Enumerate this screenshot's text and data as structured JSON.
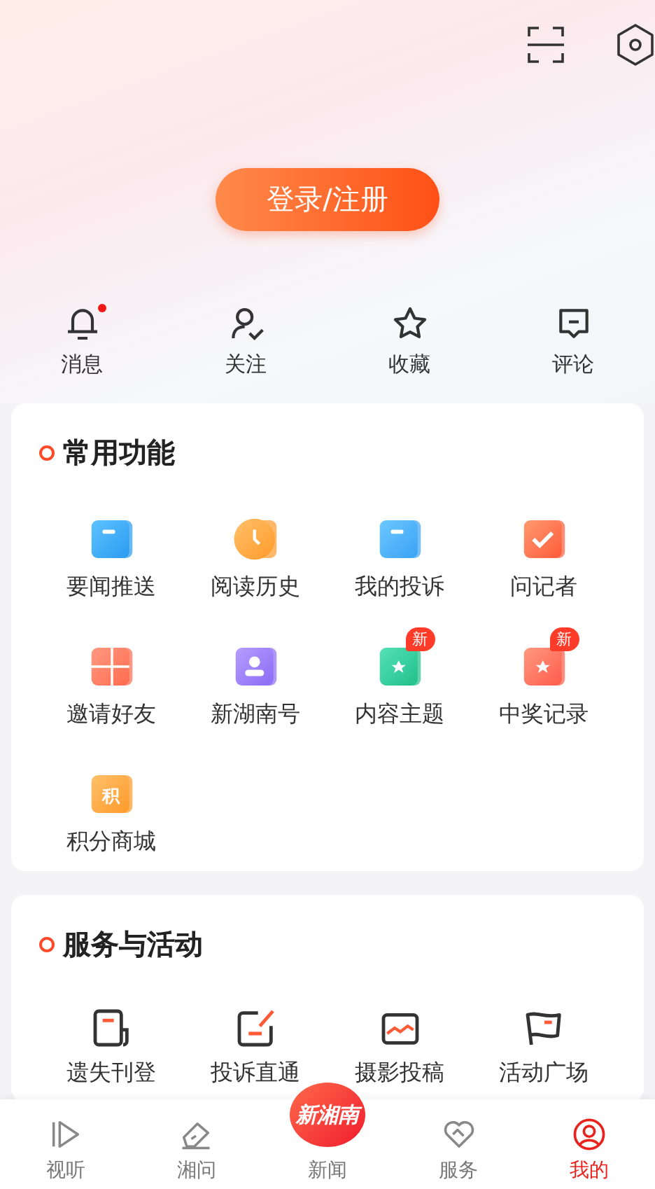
{
  "login_button": "登录/注册",
  "quick_actions": [
    {
      "label": "消息",
      "unread": true
    },
    {
      "label": "关注",
      "unread": false
    },
    {
      "label": "收藏",
      "unread": false
    },
    {
      "label": "评论",
      "unread": false
    }
  ],
  "sections": [
    {
      "title": "常用功能",
      "items": [
        {
          "label": "要闻推送"
        },
        {
          "label": "阅读历史"
        },
        {
          "label": "我的投诉"
        },
        {
          "label": "问记者"
        },
        {
          "label": "邀请好友"
        },
        {
          "label": "新湖南号"
        },
        {
          "label": "内容主题",
          "badge": "新"
        },
        {
          "label": "中奖记录",
          "badge": "新"
        },
        {
          "label": "积分商城",
          "icon_text": "积"
        }
      ]
    },
    {
      "title": "服务与活动",
      "items": [
        {
          "label": "遗失刊登"
        },
        {
          "label": "投诉直通"
        },
        {
          "label": "摄影投稿"
        },
        {
          "label": "活动广场"
        }
      ]
    }
  ],
  "tab_bar": {
    "logo_text": "新湘南",
    "items": [
      {
        "label": "视听",
        "selected": false
      },
      {
        "label": "湘问",
        "selected": false
      },
      {
        "label": "新闻",
        "selected": false
      },
      {
        "label": "服务",
        "selected": false
      },
      {
        "label": "我的",
        "selected": true
      }
    ]
  }
}
